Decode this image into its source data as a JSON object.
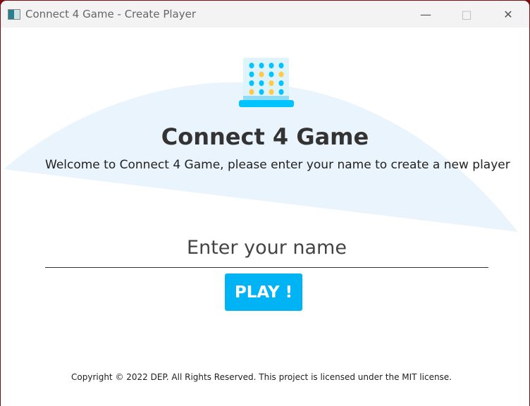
{
  "window": {
    "title": "Connect 4 Game - Create Player",
    "controls": [
      "minimize",
      "maximize",
      "close"
    ]
  },
  "header": {
    "title": "Connect 4 Game",
    "subtitle": "Welcome to Connect 4 Game, please enter your name to create a new player"
  },
  "form": {
    "name_value": "",
    "name_placeholder": "Enter your name",
    "play_label": "PLAY !"
  },
  "logo": {
    "grid": [
      [
        "b",
        "b",
        "b",
        "b"
      ],
      [
        "b",
        "y",
        "b",
        "y"
      ],
      [
        "b",
        "b",
        "y",
        "b"
      ],
      [
        "y",
        "b",
        "y",
        "b"
      ]
    ]
  },
  "colors": {
    "accent": "#00b3f5",
    "blue_disc": "#00c4ff",
    "yellow_disc": "#ffc94a",
    "shape": "#eaf4fd"
  },
  "footer": {
    "text": "Copyright © 2022 DEP. All Rights Reserved. This project is licensed under the MIT license."
  }
}
